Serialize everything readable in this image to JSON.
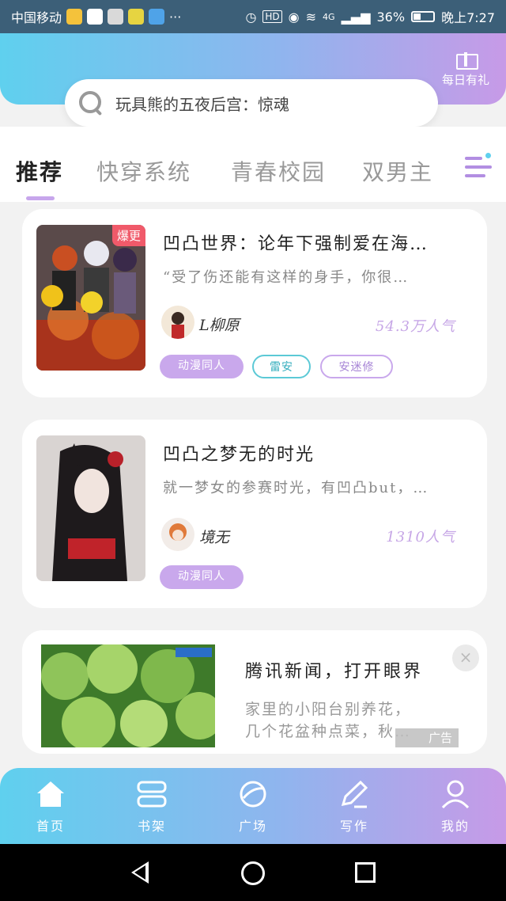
{
  "status_bar": {
    "carrier": "中国移动",
    "network": "4G",
    "battery": "36%",
    "time": "晚上7:27"
  },
  "header": {
    "gift_label": "每日有礼",
    "search_placeholder": "玩具熊的五夜后宫：惊魂"
  },
  "tabs": [
    {
      "label": "推荐"
    },
    {
      "label": "快穿系统"
    },
    {
      "label": "青春校园"
    },
    {
      "label": "双男主"
    }
  ],
  "books": [
    {
      "badge": "爆更",
      "title": "凹凸世界：论年下强制爱在海…",
      "desc": "“受了伤还能有这样的身手，你很…",
      "author": "L柳原",
      "popularity": "54.3万人气",
      "tags": [
        "动漫同人",
        "雷安",
        "安迷修"
      ]
    },
    {
      "title": "凹凸之梦无的时光",
      "desc": "就一梦女的参赛时光，有凹凸but，…",
      "author": "境无",
      "popularity": "1310人气",
      "tags": [
        "动漫同人"
      ]
    }
  ],
  "ad": {
    "title": "腾讯新闻，打开眼界",
    "desc_line1": "家里的小阳台别养花，",
    "desc_line2": "几个花盆种点菜，秋…",
    "label": "广告",
    "close": "×"
  },
  "bottom_nav": [
    {
      "label": "首页"
    },
    {
      "label": "书架"
    },
    {
      "label": "广场"
    },
    {
      "label": "写作"
    },
    {
      "label": "我的"
    }
  ]
}
